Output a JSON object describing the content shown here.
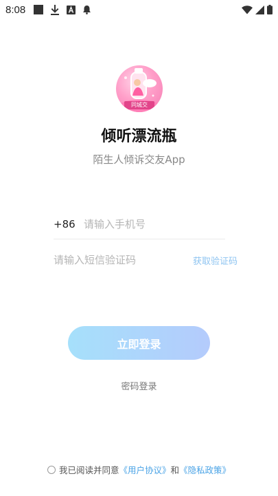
{
  "status_bar": {
    "time": "8:08",
    "left_icons": [
      "square-icon",
      "download-icon",
      "a-icon",
      "bell-icon"
    ],
    "right_icons": [
      "wifi-icon",
      "signal-icon",
      "battery-icon"
    ]
  },
  "app": {
    "logo_text": "同城交",
    "title": "倾听漂流瓶",
    "subtitle": "陌生人倾诉交友App"
  },
  "form": {
    "country_code": "+86",
    "phone_placeholder": "请输入手机号",
    "phone_value": "",
    "code_placeholder": "请输入短信验证码",
    "code_value": "",
    "get_code_label": "获取验证码"
  },
  "actions": {
    "login_label": "立即登录",
    "password_login_label": "密码登录"
  },
  "agreement": {
    "checked": false,
    "prefix": "我已阅读并同意",
    "user_agreement": "《用户协议》",
    "conjunction": "和",
    "privacy_policy": "《隐私政策》"
  },
  "colors": {
    "link": "#4aa3e6",
    "get_code": "#8ec4f1",
    "button_start": "#a6e0fb",
    "button_end": "#b4cbfc",
    "logo_pink": "#f57bb2"
  }
}
